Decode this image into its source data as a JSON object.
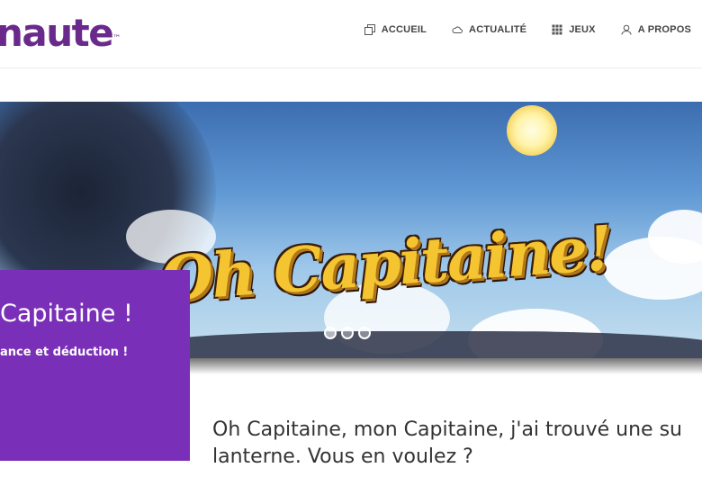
{
  "header": {
    "logo_text": "naute",
    "logo_tm": "™",
    "nav": [
      {
        "label": "ACCUEIL",
        "icon": "copy-icon"
      },
      {
        "label": "ACTUALITÉ",
        "icon": "cloud-icon"
      },
      {
        "label": "JEUX",
        "icon": "grid-icon"
      },
      {
        "label": "A PROPOS",
        "icon": "user-icon"
      }
    ]
  },
  "hero": {
    "title": "Oh Capitaine!",
    "slides_count": 3,
    "active_slide": 1
  },
  "card": {
    "title": "Capitaine !",
    "subtitle": "ance et déduction !"
  },
  "article": {
    "lead_line1": "Oh Capitaine, mon Capitaine, j'ai trouvé une su",
    "lead_line2": "lanterne. Vous en voulez ?"
  },
  "colors": {
    "brand_purple": "#6a2a8c",
    "card_purple": "#7a2fb8",
    "title_yellow": "#f4c531"
  }
}
